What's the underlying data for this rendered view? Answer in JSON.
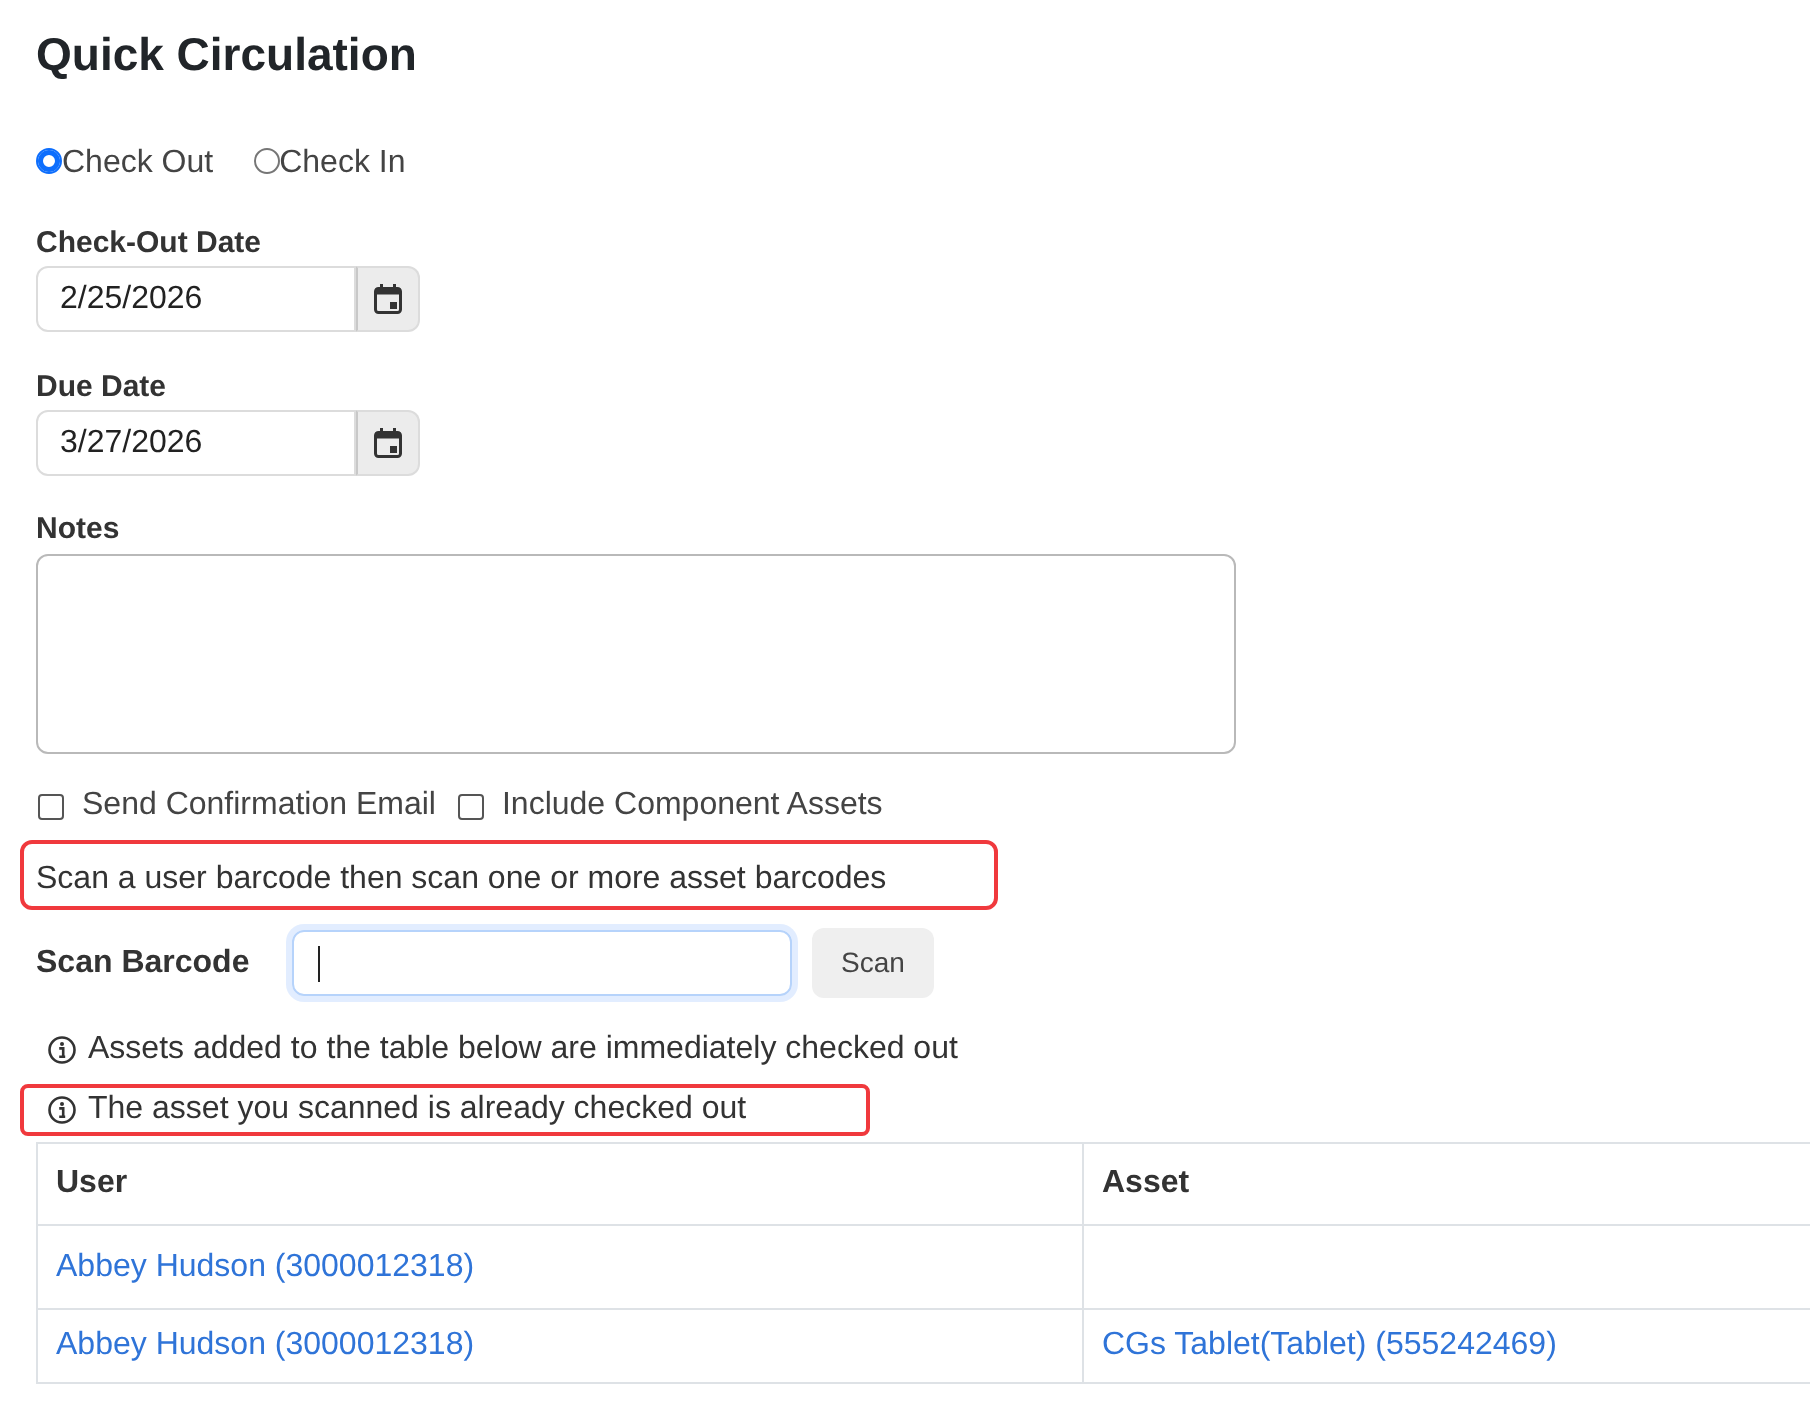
{
  "title": "Quick Circulation",
  "mode_options": [
    {
      "label": "Check Out",
      "selected": true
    },
    {
      "label": "Check In",
      "selected": false
    }
  ],
  "date_fields": [
    {
      "label": "Check-Out Date",
      "value": "2/25/2026"
    },
    {
      "label": "Due Date",
      "value": "3/27/2026"
    }
  ],
  "notes": {
    "label": "Notes"
  },
  "options": [
    {
      "label": "Send Confirmation Email",
      "checked": false
    },
    {
      "label": "Include Component Assets",
      "checked": false
    }
  ],
  "instruction": {
    "text": "Scan a user barcode then scan one or more asset barcodes",
    "highlighted": true
  },
  "scan": {
    "label": "Scan Barcode",
    "focused": true,
    "button": "Scan"
  },
  "messages": [
    {
      "text": "Assets added to the table below are immediately checked out",
      "highlighted": false
    },
    {
      "text": "The asset you scanned is already checked out",
      "highlighted": true
    }
  ],
  "table": {
    "columns": [
      "User",
      "Asset"
    ],
    "rows": [
      {
        "user": "Abbey Hudson (3000012318)"
      },
      {
        "user": "Abbey Hudson (3000012318)",
        "asset": "CGs Tablet(Tablet) (555242469)"
      }
    ]
  }
}
